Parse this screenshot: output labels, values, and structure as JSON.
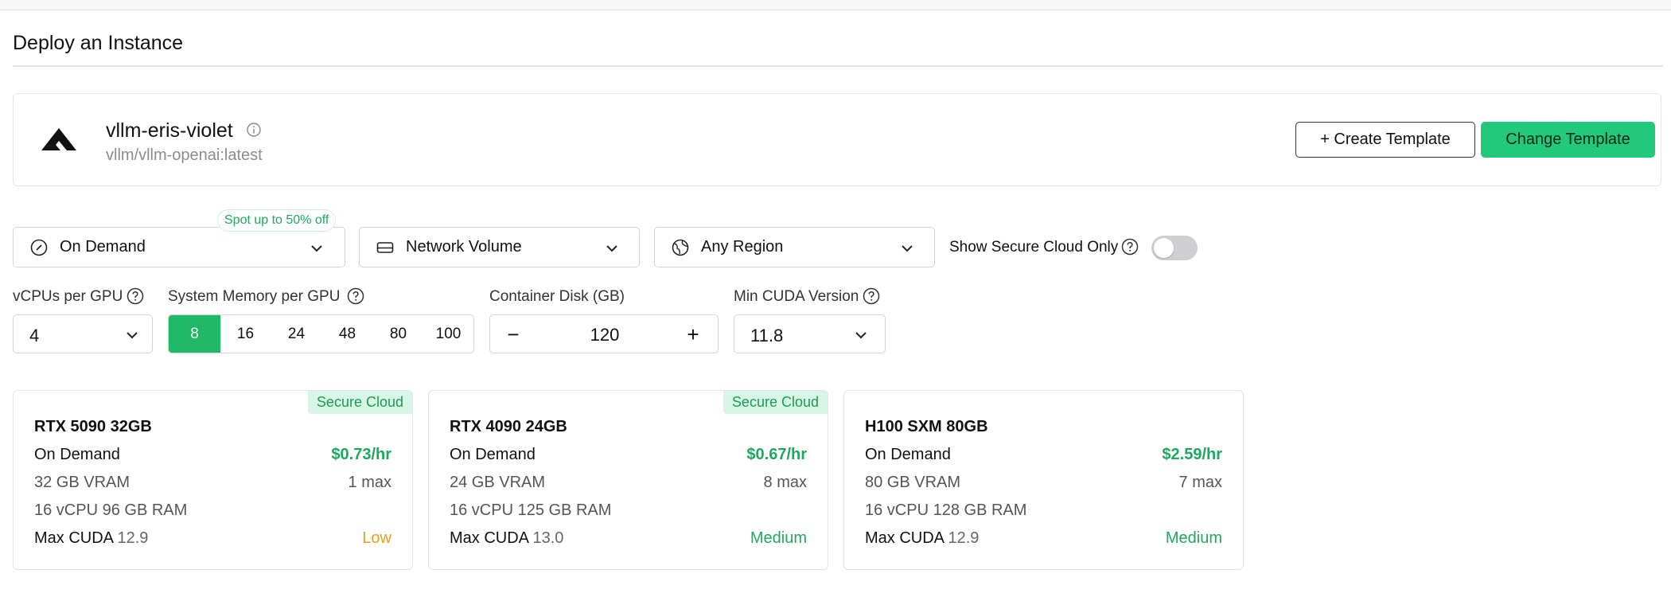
{
  "page": {
    "title": "Deploy an Instance"
  },
  "template": {
    "name": "vllm-eris-violet",
    "image": "vllm/vllm-openai:latest",
    "create_label": "+ Create Template",
    "change_label": "Change Template",
    "logo_icon": "runpod-logo-icon"
  },
  "filters": {
    "pricing": {
      "value": "On Demand",
      "badge": "Spot up to 50% off",
      "icon": "gauge-icon"
    },
    "volume": {
      "value": "Network Volume",
      "icon": "drive-icon"
    },
    "region": {
      "value": "Any Region",
      "icon": "globe-icon"
    },
    "secure_cloud": {
      "label": "Show Secure Cloud Only",
      "enabled": false
    }
  },
  "fields": {
    "vcpus": {
      "label": "vCPUs per GPU",
      "value": "4"
    },
    "memory": {
      "label": "System Memory per GPU",
      "options": [
        "8",
        "16",
        "24",
        "48",
        "80",
        "100"
      ],
      "selected": "8"
    },
    "container_disk": {
      "label": "Container Disk (GB)",
      "value": "120",
      "minus": "−",
      "plus": "+"
    },
    "cuda": {
      "label": "Min CUDA Version",
      "value": "11.8"
    }
  },
  "gpus": [
    {
      "name": "RTX 5090 32GB",
      "badge": "Secure Cloud",
      "pricing": "On Demand",
      "price": "$0.73/hr",
      "vram": "32 GB VRAM",
      "max": "1 max",
      "specs": "16 vCPU 96 GB RAM",
      "cuda_label": "Max CUDA",
      "cuda": "12.9",
      "availability": "Low",
      "availability_color": "#e6a11a"
    },
    {
      "name": "RTX 4090 24GB",
      "badge": "Secure Cloud",
      "pricing": "On Demand",
      "price": "$0.67/hr",
      "vram": "24 GB VRAM",
      "max": "8 max",
      "specs": "16 vCPU 125 GB RAM",
      "cuda_label": "Max CUDA",
      "cuda": "13.0",
      "availability": "Medium",
      "availability_color": "#1ea85f"
    },
    {
      "name": "H100 SXM 80GB",
      "badge": "",
      "pricing": "On Demand",
      "price": "$2.59/hr",
      "vram": "80 GB VRAM",
      "max": "7 max",
      "specs": "16 vCPU 128 GB RAM",
      "cuda_label": "Max CUDA",
      "cuda": "12.9",
      "availability": "Medium",
      "availability_color": "#1ea85f"
    }
  ],
  "colors": {
    "accent": "#22c97a",
    "selected": "#1fb866",
    "price": "#1ea85f"
  }
}
